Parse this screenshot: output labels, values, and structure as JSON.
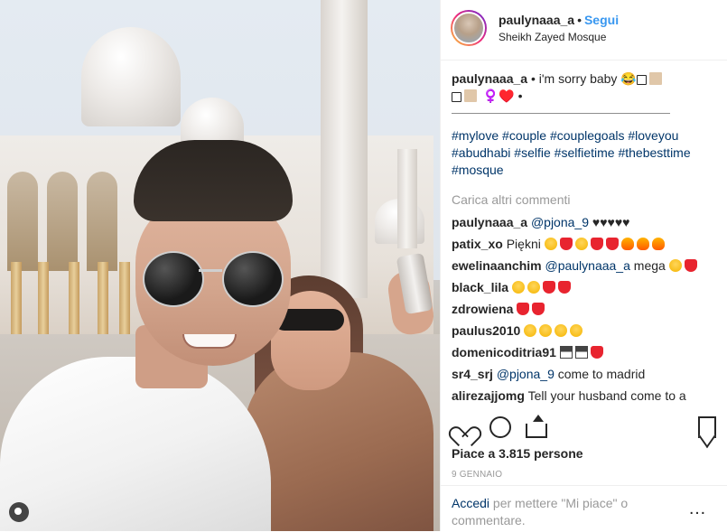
{
  "header": {
    "username": "paulynaaa_a",
    "separator": "•",
    "follow_label": "Segui",
    "location": "Sheikh Zayed Mosque"
  },
  "caption": {
    "username": "paulynaaa_a",
    "text_line1": " • i'm sorry baby 😂",
    "text_line2": " ♀️♥️ •",
    "hashtags": [
      "#mylove",
      "#couple",
      "#couplegoals",
      "#loveyou",
      "#abudhabi",
      "#selfie",
      "#selfietime",
      "#thebesttime",
      "#mosque"
    ]
  },
  "load_more_label": "Carica altri commenti",
  "comments": [
    {
      "user": "paulynaaa_a",
      "mention": "@pjona_9",
      "text": " ♥♥♥♥♥",
      "emojis": []
    },
    {
      "user": "patix_xo",
      "mention": "",
      "text": "Piękni",
      "emojis": [
        "smile",
        "heart",
        "smile",
        "heart",
        "heart",
        "fire",
        "fire",
        "fire"
      ]
    },
    {
      "user": "ewelinaanchim",
      "mention": "@paulynaaa_a",
      "text": " mega",
      "emojis": [
        "smile",
        "heart"
      ]
    },
    {
      "user": "black_lila",
      "mention": "",
      "text": "",
      "emojis": [
        "smile",
        "smile",
        "heart",
        "heart"
      ]
    },
    {
      "user": "zdrowiena",
      "mention": "",
      "text": "",
      "emojis": [
        "heart",
        "heart"
      ]
    },
    {
      "user": "paulus2010",
      "mention": "",
      "text": "",
      "emojis": [
        "smile",
        "smile",
        "smile",
        "smile"
      ]
    },
    {
      "user": "domenicoditria91",
      "mention": "",
      "text": "",
      "emojis": [
        "top",
        "top",
        "heart"
      ]
    },
    {
      "user": "sr4_srj",
      "mention": "@pjona_9",
      "text": " come to madrid",
      "emojis": []
    },
    {
      "user": "alirezajjomg",
      "mention": "",
      "text": "Tell your husband come to a",
      "emojis": []
    }
  ],
  "likes_text": "Piace a 3.815 persone",
  "date_text": "9 GENNAIO",
  "footer": {
    "login_link": "Accedi",
    "rest": " per mettere \"Mi piace\" o commentare.",
    "more": "…"
  },
  "icons": {
    "like": "heart-icon",
    "comment": "comment-icon",
    "share": "share-icon",
    "save": "bookmark-icon",
    "more": "more-options-icon",
    "photo_badge": "user-tag-icon"
  },
  "colors": {
    "link": "#003569",
    "follow": "#3897f0",
    "muted": "#999999",
    "text": "#262626"
  }
}
